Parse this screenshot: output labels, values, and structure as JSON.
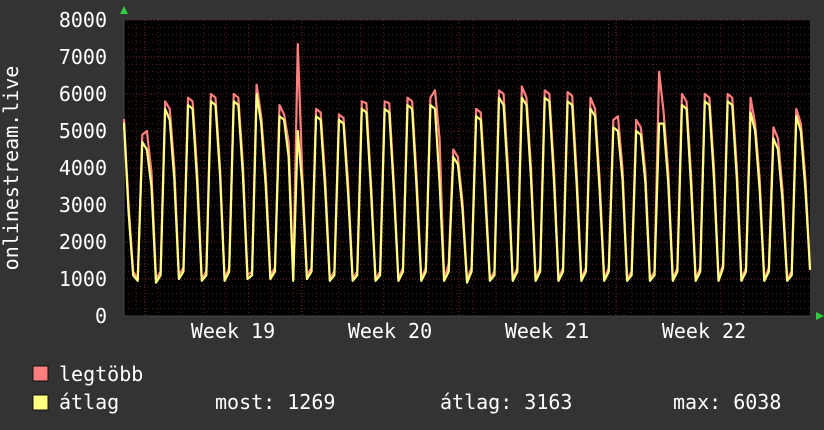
{
  "chart_data": {
    "type": "line",
    "ylabel": "onlinestream.live",
    "ylim": [
      0,
      8000
    ],
    "yticks": [
      0,
      1000,
      2000,
      3000,
      4000,
      5000,
      6000,
      7000,
      8000
    ],
    "xlabels": [
      "Week 19",
      "Week 20",
      "Week 21",
      "Week 22"
    ],
    "grid": true,
    "series": [
      {
        "name": "legtöbb",
        "color": "#ff7f7f",
        "values": [
          5300,
          3000,
          1200,
          1000,
          4900,
          5000,
          3900,
          1000,
          1200,
          5800,
          5600,
          4000,
          1100,
          1300,
          5900,
          5800,
          3900,
          1000,
          1200,
          6000,
          5900,
          4000,
          1000,
          1300,
          6000,
          5900,
          4100,
          1100,
          1200,
          6250,
          5400,
          3800,
          1100,
          1300,
          5700,
          5450,
          4700,
          1000,
          7350,
          3800,
          1100,
          1300,
          5600,
          5500,
          3700,
          1000,
          1200,
          5450,
          5350,
          3600,
          1000,
          1200,
          5800,
          5750,
          3600,
          1000,
          1200,
          5800,
          5750,
          3600,
          1000,
          1300,
          5900,
          5800,
          3700,
          1000,
          1300,
          5900,
          6100,
          4800,
          1000,
          1400,
          4500,
          4300,
          3100,
          1000,
          1300,
          5600,
          5500,
          3500,
          1000,
          1200,
          6100,
          6000,
          3900,
          1000,
          1300,
          6200,
          5900,
          4000,
          1000,
          1300,
          6100,
          6000,
          4000,
          1000,
          1300,
          6050,
          5950,
          3800,
          1000,
          1300,
          5900,
          5600,
          3700,
          1000,
          1300,
          5300,
          5400,
          4000,
          1000,
          1200,
          5300,
          5100,
          3900,
          1000,
          1200,
          6600,
          5500,
          3900,
          1000,
          1300,
          6000,
          5800,
          3800,
          1000,
          1300,
          6000,
          5900,
          4000,
          1000,
          1400,
          6000,
          5900,
          4000,
          1000,
          1300,
          5900,
          5200,
          3700,
          1000,
          1300,
          5100,
          4800,
          3400,
          1000,
          1200,
          5600,
          5200,
          3700,
          1269
        ]
      },
      {
        "name": "átlag",
        "color": "#ffff80",
        "values": [
          5200,
          2800,
          1100,
          950,
          4700,
          4500,
          3500,
          900,
          1100,
          5600,
          5300,
          3700,
          1000,
          1200,
          5700,
          5600,
          3600,
          950,
          1100,
          5800,
          5700,
          3800,
          950,
          1200,
          5800,
          5700,
          3800,
          1000,
          1100,
          6000,
          5200,
          3500,
          1000,
          1200,
          5400,
          5300,
          4300,
          950,
          5000,
          3500,
          1000,
          1200,
          5400,
          5300,
          3400,
          950,
          1100,
          5300,
          5200,
          3300,
          950,
          1100,
          5600,
          5500,
          3400,
          950,
          1100,
          5600,
          5500,
          3400,
          950,
          1200,
          5700,
          5600,
          3400,
          950,
          1200,
          5700,
          5600,
          3600,
          950,
          1200,
          4300,
          4100,
          2900,
          900,
          1200,
          5400,
          5300,
          3200,
          950,
          1100,
          5900,
          5700,
          3600,
          950,
          1200,
          5900,
          5700,
          3700,
          950,
          1200,
          5900,
          5800,
          3700,
          950,
          1200,
          5800,
          5700,
          3500,
          950,
          1200,
          5600,
          5400,
          3400,
          950,
          1200,
          5100,
          5000,
          3700,
          950,
          1100,
          5000,
          4900,
          3600,
          950,
          1100,
          5200,
          5200,
          3600,
          950,
          1200,
          5700,
          5600,
          3500,
          950,
          1200,
          5800,
          5700,
          3700,
          950,
          1300,
          5800,
          5700,
          3700,
          950,
          1200,
          5500,
          5000,
          3400,
          950,
          1200,
          4800,
          4500,
          3100,
          950,
          1100,
          5400,
          5000,
          3400,
          1269
        ]
      }
    ]
  },
  "legend": [
    {
      "label": "legtöbb",
      "color": "#ff7f7f"
    },
    {
      "label": "átlag",
      "color": "#ffff80"
    }
  ],
  "stats": {
    "now": "most: 1269",
    "avg": "átlag: 3163",
    "max": "max: 6038"
  }
}
